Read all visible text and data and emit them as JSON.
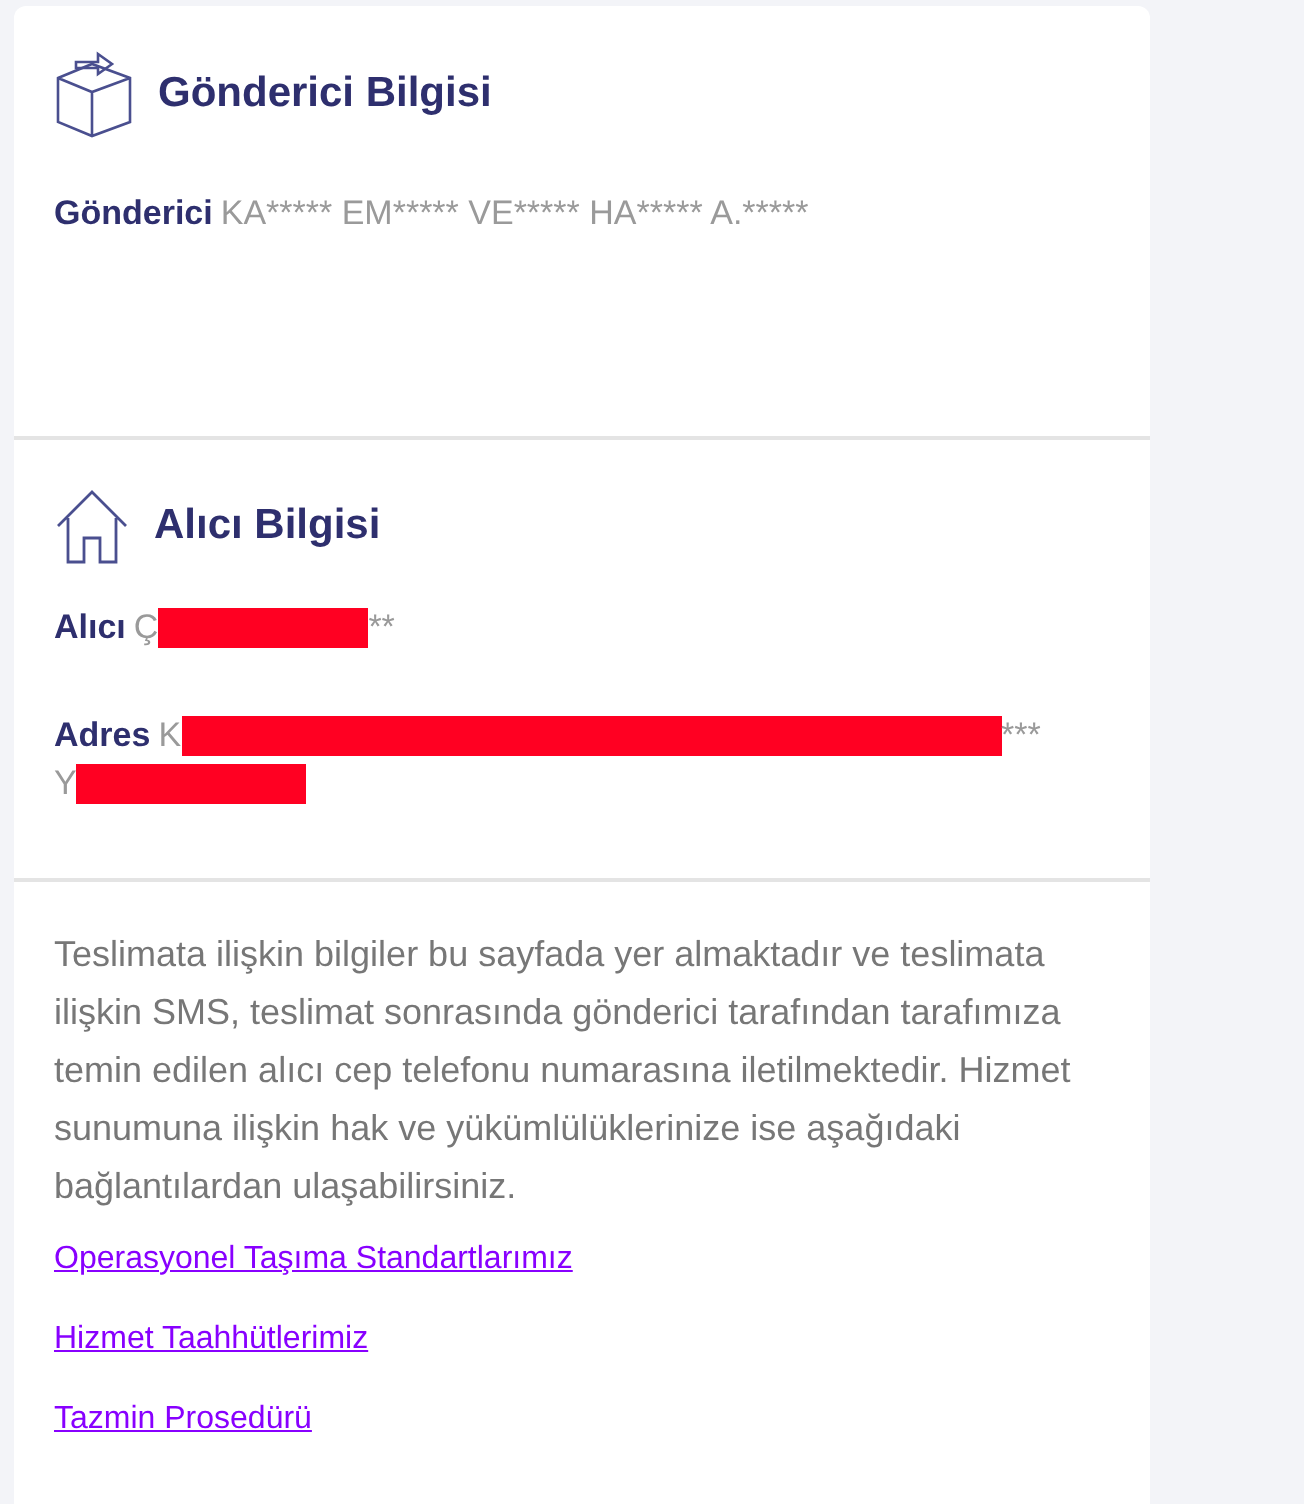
{
  "sender": {
    "title": "Gönderici Bilgisi",
    "fields": [
      {
        "label": "Gönderici",
        "value_start": "KA***** EM***** VE***** HA***** A.*****",
        "redacted": false
      }
    ]
  },
  "recipient": {
    "title": "Alıcı Bilgisi",
    "fields": [
      {
        "label": "Alıcı",
        "value_start": "Ç",
        "value_end": "**",
        "redacted": true
      },
      {
        "label": "Adres",
        "value_start": "K",
        "value_end": "***",
        "redacted": true,
        "second_line": "Y",
        "second_line_redacted": true
      }
    ]
  },
  "info": {
    "text": "Teslimata ilişkin bilgiler bu sayfada yer almaktadır ve teslimata ilişkin SMS, teslimat sonrasında gönderici tarafından tarafımıza temin edilen alıcı cep telefonu numarasına iletilmektedir. Hizmet sunumuna ilişkin hak ve yükümlülüklerinize ise aşağıdaki bağlantılardan ulaşabilirsiniz.",
    "links": [
      "Operasyonel Taşıma Standartlarımız",
      "Hizmet Taahhütlerimiz",
      "Tazmin Prosedürü"
    ]
  }
}
